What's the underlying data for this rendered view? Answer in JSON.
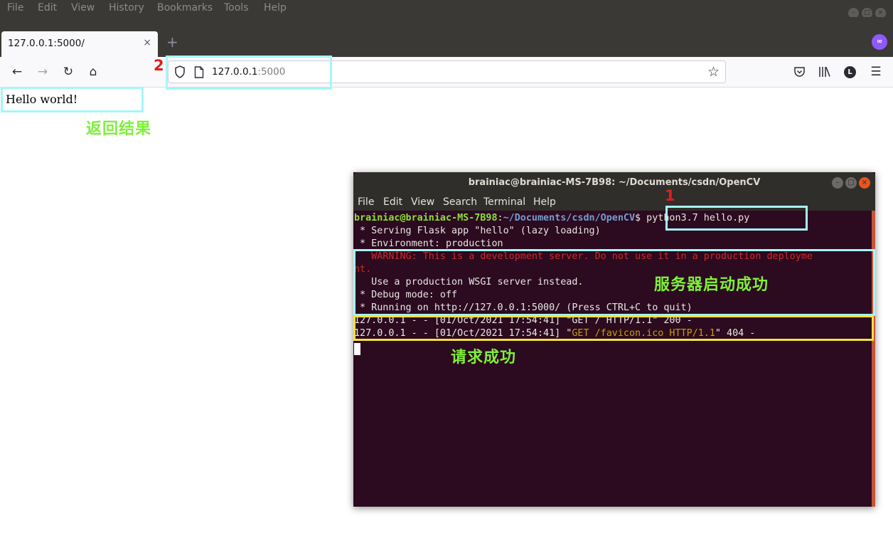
{
  "browser": {
    "menu": [
      "File",
      "Edit",
      "View",
      "History",
      "Bookmarks",
      "Tools",
      "Help"
    ],
    "tab_title": "127.0.0.1:5000/",
    "tab_close": "×",
    "new_tab": "+",
    "account_initial": "L",
    "url_host": "127.0.0.1",
    "url_port": ":5000",
    "icons": [
      "back-arrow-icon",
      "forward-arrow-icon",
      "reload-icon",
      "home-icon",
      "shield-icon",
      "page-icon",
      "star-icon",
      "pocket-icon",
      "library-icon",
      "account-icon",
      "hamburger-menu-icon"
    ]
  },
  "page": {
    "body_text": "Hello world!"
  },
  "annotations": {
    "num1": "1",
    "num2": "2",
    "label_result": "返回结果",
    "label_server": "服务器启动成功",
    "label_request": "请求成功",
    "box_color": "#a6f6f8",
    "box_yellow": "#f3e13b"
  },
  "terminal": {
    "title": "brainiac@brainiac-MS-7B98: ~/Documents/csdn/OpenCV",
    "menu": [
      "File",
      "Edit",
      "View",
      "Search",
      "Terminal",
      "Help"
    ],
    "prompt_user": "brainiac@brainiac-MS-7B98",
    "prompt_sep": ":",
    "prompt_path": "~/Documents/csdn/OpenCV",
    "prompt_cmd": "$ python3.7 hello.py",
    "line_serving": " * Serving Flask app \"hello\" (lazy loading)",
    "line_env": " * Environment: production",
    "line_warn_a": "   WARNING: This is a development server. Do not use it in a production deployme",
    "line_warn_b": "nt.",
    "line_wsgi": "   Use a production WSGI server instead.",
    "line_debug": " * Debug mode: off",
    "line_running": " * Running on http://127.0.0.1:5000/ (Press CTRL+C to quit)",
    "req1_prefix": "127.0.0.1 - - [01/Oct/2021 17:54:41] \"",
    "req1_path": "GET / HTTP/1.1",
    "req1_suffix": "\" 200 -",
    "req2_prefix": "127.0.0.1 - - [01/Oct/2021 17:54:41] \"",
    "req2_path": "GET /favicon.ico HTTP/1.1",
    "req2_suffix": "\" 404 -"
  }
}
